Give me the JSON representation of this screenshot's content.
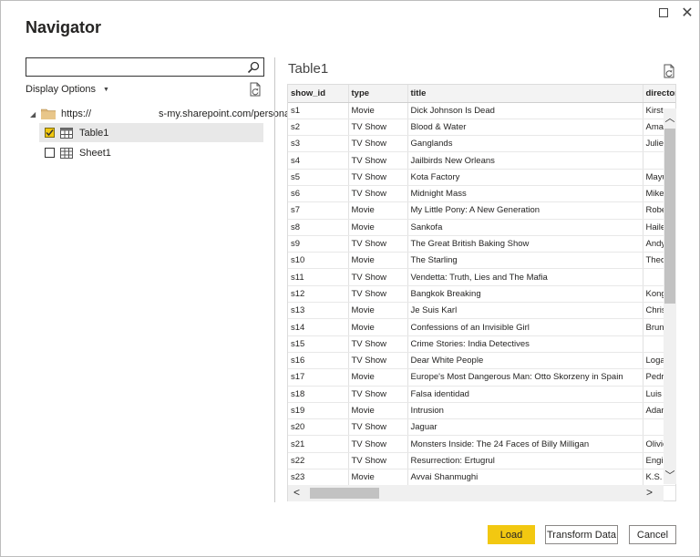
{
  "window": {
    "title": "Navigator",
    "maximize_icon": "maximize-icon",
    "close_icon": "close-icon",
    "close_glyph": "✕"
  },
  "left_pane": {
    "search": {
      "value": "",
      "placeholder": ""
    },
    "display_options_label": "Display Options",
    "tree": {
      "root": {
        "prefix": "https://",
        "suffix": "s-my.sharepoint.com/personal..."
      },
      "items": [
        {
          "label": "Table1",
          "checked": true,
          "selected": true,
          "icon": "table-icon"
        },
        {
          "label": "Sheet1",
          "checked": false,
          "selected": false,
          "icon": "sheet-icon"
        }
      ]
    }
  },
  "preview": {
    "title": "Table1",
    "columns": [
      "show_id",
      "type",
      "title",
      "director"
    ],
    "rows": [
      [
        "s1",
        "Movie",
        "Dick Johnson Is Dead",
        "Kirste"
      ],
      [
        "s2",
        "TV Show",
        "Blood & Water",
        "Ama"
      ],
      [
        "s3",
        "TV Show",
        "Ganglands",
        "Julien"
      ],
      [
        "s4",
        "TV Show",
        "Jailbirds New Orleans",
        ""
      ],
      [
        "s5",
        "TV Show",
        "Kota Factory",
        "Mayu"
      ],
      [
        "s6",
        "TV Show",
        "Midnight Mass",
        "Mike"
      ],
      [
        "s7",
        "Movie",
        "My Little Pony: A New Generation",
        "Robe"
      ],
      [
        "s8",
        "Movie",
        "Sankofa",
        "Haile"
      ],
      [
        "s9",
        "TV Show",
        "The Great British Baking Show",
        "Andy"
      ],
      [
        "s10",
        "Movie",
        "The Starling",
        "Theo"
      ],
      [
        "s11",
        "TV Show",
        "Vendetta: Truth, Lies and The Mafia",
        ""
      ],
      [
        "s12",
        "TV Show",
        "Bangkok Breaking",
        "Kong"
      ],
      [
        "s13",
        "Movie",
        "Je Suis Karl",
        "Chris"
      ],
      [
        "s14",
        "Movie",
        "Confessions of an Invisible Girl",
        "Brun"
      ],
      [
        "s15",
        "TV Show",
        "Crime Stories: India Detectives",
        ""
      ],
      [
        "s16",
        "TV Show",
        "Dear White People",
        "Loga"
      ],
      [
        "s17",
        "Movie",
        "Europe's Most Dangerous Man: Otto Skorzeny in Spain",
        "Pedr"
      ],
      [
        "s18",
        "TV Show",
        "Falsa identidad",
        "Luis F"
      ],
      [
        "s19",
        "Movie",
        "Intrusion",
        "Adam"
      ],
      [
        "s20",
        "TV Show",
        "Jaguar",
        ""
      ],
      [
        "s21",
        "TV Show",
        "Monsters Inside: The 24 Faces of Billy Milligan",
        "Olivie"
      ],
      [
        "s22",
        "TV Show",
        "Resurrection: Ertugrul",
        "Engin"
      ],
      [
        "s23",
        "Movie",
        "Avvai Shanmughi",
        "K.S. F"
      ]
    ]
  },
  "footer": {
    "load_label": "Load",
    "transform_label": "Transform Data",
    "cancel_label": "Cancel"
  },
  "colors": {
    "accent": "#f2c811",
    "selected_row": "#e8e8e8",
    "header_bg": "#f3f3f3"
  }
}
